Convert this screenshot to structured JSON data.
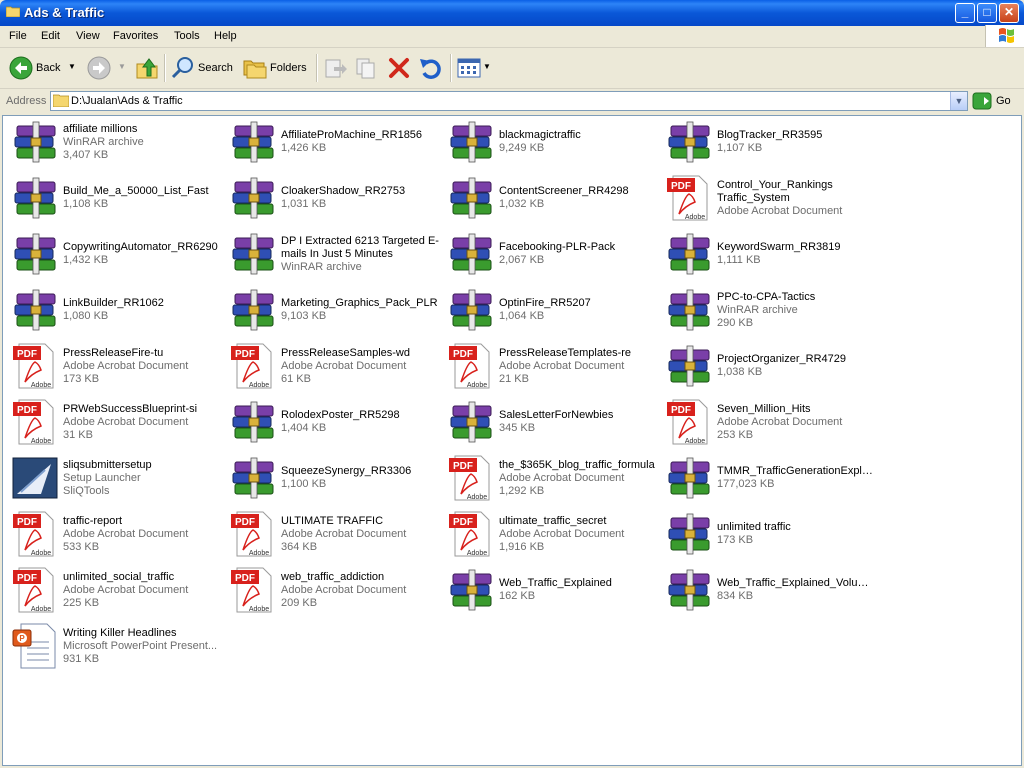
{
  "window": {
    "title": "Ads & Traffic",
    "minimize": "_",
    "maximize": "□",
    "close": "✕"
  },
  "menu": [
    "File",
    "Edit",
    "View",
    "Favorites",
    "Tools",
    "Help"
  ],
  "toolbar": {
    "back": "Back",
    "search": "Search",
    "folders": "Folders"
  },
  "address": {
    "label": "Address",
    "path": "D:\\Jualan\\Ads & Traffic",
    "go": "Go"
  },
  "files": [
    {
      "name": "affiliate millions",
      "type": "WinRAR archive",
      "size": "3,407 KB",
      "icon": "rar"
    },
    {
      "name": "AffiliateProMachine_RR1856",
      "type": "",
      "size": "1,426 KB",
      "icon": "rar"
    },
    {
      "name": "blackmagictraffic",
      "type": "",
      "size": "9,249 KB",
      "icon": "rar"
    },
    {
      "name": "BlogTracker_RR3595",
      "type": "",
      "size": "1,107 KB",
      "icon": "rar"
    },
    {
      "name": "Build_Me_a_50000_List_Fast",
      "type": "",
      "size": "1,108 KB",
      "icon": "rar"
    },
    {
      "name": "CloakerShadow_RR2753",
      "type": "",
      "size": "1,031 KB",
      "icon": "rar"
    },
    {
      "name": "ContentScreener_RR4298",
      "type": "",
      "size": "1,032 KB",
      "icon": "rar"
    },
    {
      "name": "Control_Your_Rankings Traffic_System",
      "type": "Adobe Acrobat Document",
      "size": "",
      "icon": "pdf"
    },
    {
      "name": "CopywritingAutomator_RR6290",
      "type": "",
      "size": "1,432 KB",
      "icon": "rar"
    },
    {
      "name": "DP I Extracted 6213 Targeted E-mails In Just 5 Minutes",
      "type": "WinRAR archive",
      "size": "",
      "icon": "rar"
    },
    {
      "name": "Facebooking-PLR-Pack",
      "type": "",
      "size": "2,067 KB",
      "icon": "rar"
    },
    {
      "name": "KeywordSwarm_RR3819",
      "type": "",
      "size": "1,111 KB",
      "icon": "rar"
    },
    {
      "name": "LinkBuilder_RR1062",
      "type": "",
      "size": "1,080 KB",
      "icon": "rar"
    },
    {
      "name": "Marketing_Graphics_Pack_PLR",
      "type": "",
      "size": "9,103 KB",
      "icon": "rar"
    },
    {
      "name": "OptinFire_RR5207",
      "type": "",
      "size": "1,064 KB",
      "icon": "rar"
    },
    {
      "name": "PPC-to-CPA-Tactics",
      "type": "WinRAR archive",
      "size": "290 KB",
      "icon": "rar"
    },
    {
      "name": "PressReleaseFire-tu",
      "type": "Adobe Acrobat Document",
      "size": "173 KB",
      "icon": "pdf"
    },
    {
      "name": "PressReleaseSamples-wd",
      "type": "Adobe Acrobat Document",
      "size": "61 KB",
      "icon": "pdf"
    },
    {
      "name": "PressReleaseTemplates-re",
      "type": "Adobe Acrobat Document",
      "size": "21 KB",
      "icon": "pdf"
    },
    {
      "name": "ProjectOrganizer_RR4729",
      "type": "",
      "size": "1,038 KB",
      "icon": "rar"
    },
    {
      "name": "PRWebSuccessBlueprint-si",
      "type": "Adobe Acrobat Document",
      "size": "31 KB",
      "icon": "pdf"
    },
    {
      "name": "RolodexPoster_RR5298",
      "type": "",
      "size": "1,404 KB",
      "icon": "rar"
    },
    {
      "name": "SalesLetterForNewbies",
      "type": "",
      "size": "345 KB",
      "icon": "rar"
    },
    {
      "name": "Seven_Million_Hits",
      "type": "Adobe Acrobat Document",
      "size": "253 KB",
      "icon": "pdf"
    },
    {
      "name": "sliqsubmittersetup",
      "type": "Setup Launcher",
      "size": "SliQTools",
      "icon": "setup"
    },
    {
      "name": "SqueezeSynergy_RR3306",
      "type": "",
      "size": "1,100 KB",
      "icon": "rar"
    },
    {
      "name": "the_$365K_blog_traffic_formula",
      "type": "Adobe Acrobat Document",
      "size": "1,292 KB",
      "icon": "pdf"
    },
    {
      "name": "TMMR_TrafficGenerationExplo...",
      "type": "",
      "size": "177,023 KB",
      "icon": "rar"
    },
    {
      "name": "traffic-report",
      "type": "Adobe Acrobat Document",
      "size": "533 KB",
      "icon": "pdf"
    },
    {
      "name": "ULTIMATE TRAFFIC",
      "type": "Adobe Acrobat Document",
      "size": "364 KB",
      "icon": "pdf"
    },
    {
      "name": "ultimate_traffic_secret",
      "type": "Adobe Acrobat Document",
      "size": "1,916 KB",
      "icon": "pdf"
    },
    {
      "name": "unlimited traffic",
      "type": "",
      "size": "173 KB",
      "icon": "rar"
    },
    {
      "name": "unlimited_social_traffic",
      "type": "Adobe Acrobat Document",
      "size": "225 KB",
      "icon": "pdf"
    },
    {
      "name": "web_traffic_addiction",
      "type": "Adobe Acrobat Document",
      "size": "209 KB",
      "icon": "pdf"
    },
    {
      "name": "Web_Traffic_Explained",
      "type": "",
      "size": "162 KB",
      "icon": "rar"
    },
    {
      "name": "Web_Traffic_Explained_Volum...",
      "type": "",
      "size": "834 KB",
      "icon": "rar"
    },
    {
      "name": "Writing Killer Headlines",
      "type": "Microsoft PowerPoint Present...",
      "size": "931 KB",
      "icon": "ppt"
    }
  ],
  "icons": {
    "rar": "winrar-archive-icon",
    "pdf": "pdf-document-icon",
    "setup": "setup-launcher-icon",
    "ppt": "powerpoint-document-icon"
  },
  "colors": {
    "titlebar": "#0a58d8",
    "pdf_red": "#d8211c",
    "address_border": "#7f9db9"
  }
}
